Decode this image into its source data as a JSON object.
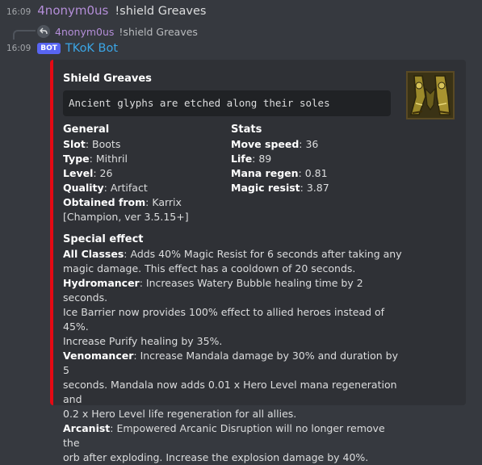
{
  "message1": {
    "timestamp": "16:09",
    "username": "4nonym0us",
    "text": "!shield Greaves"
  },
  "reply": {
    "username": "4nonym0us",
    "text": "!shield Greaves",
    "icon": "reply-arrow-icon"
  },
  "message2": {
    "timestamp": "16:09",
    "badge": "BOT",
    "username": "TKoK Bot"
  },
  "embed": {
    "accent_color": "#e50913",
    "title": "Shield Greaves",
    "code": "Ancient glyphs are etched along their soles",
    "general": {
      "heading": "General",
      "slot_label": "Slot",
      "slot_value": "Boots",
      "type_label": "Type",
      "type_value": "Mithril",
      "level_label": "Level",
      "level_value": "26",
      "quality_label": "Quality",
      "quality_value": "Artifact",
      "obtained_label": "Obtained from",
      "obtained_value": "Karrix",
      "obtained_line2": "[Champion, ver 3.5.15+]"
    },
    "stats": {
      "heading": "Stats",
      "move_label": "Move speed",
      "move_value": "36",
      "life_label": "Life",
      "life_value": "89",
      "mana_label": "Mana regen",
      "mana_value": "0.81",
      "magic_label": "Magic resist",
      "magic_value": "3.87"
    },
    "special": {
      "heading": "Special effect",
      "all_label": "All Classes",
      "all_l1": "Adds 40% Magic Resist for 6 seconds after taking any",
      "all_l2": "magic damage. This effect has a cooldown of 20 seconds.",
      "hydro_label": "Hydromancer",
      "hydro_l1": "Increases Watery Bubble healing time by 2 seconds.",
      "hydro_l2": "Ice Barrier now provides 100% effect to allied heroes instead of 45%.",
      "hydro_l3": "Increase Purify healing by 35%.",
      "veno_label": "Venomancer",
      "veno_l1": "Increase Mandala damage by 30% and duration by 5",
      "veno_l2": "seconds. Mandala now adds 0.01 x Hero Level mana regeneration and",
      "veno_l3": "0.2 x Hero Level life regeneration for all allies.",
      "arc_label": "Arcanist",
      "arc_l1": "Empowered Arcanic Disruption will no longer remove the",
      "arc_l2": "orb after exploding. Increase the explosion damage by 40%."
    },
    "thumbnail_icon": "greaves-item-icon"
  }
}
